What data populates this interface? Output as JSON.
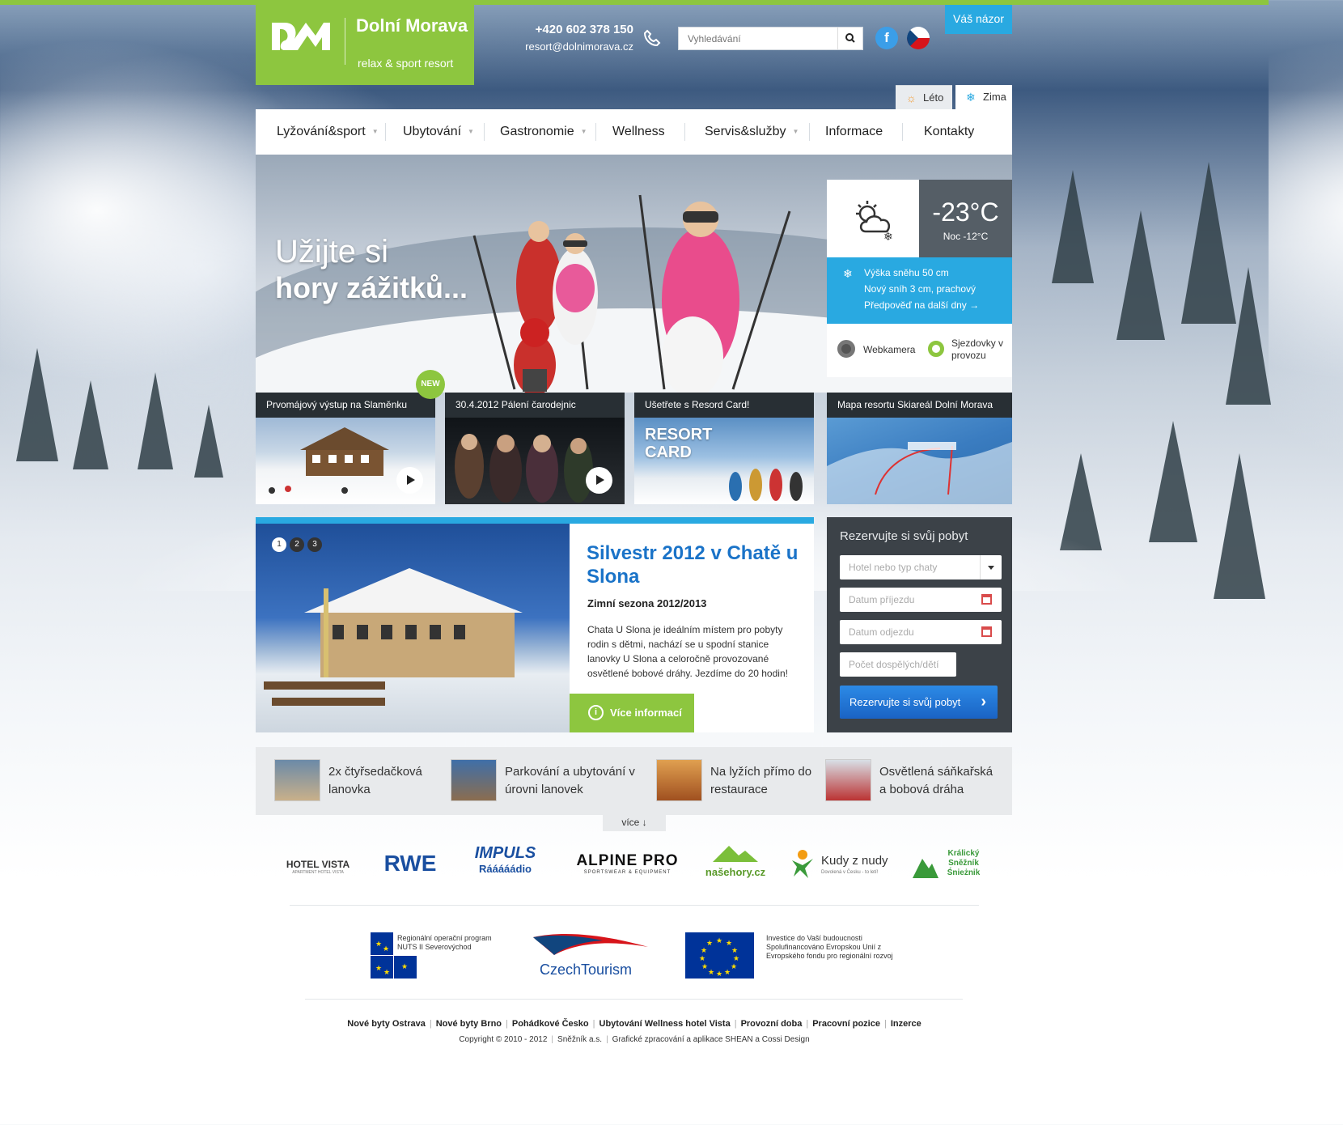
{
  "header": {
    "logo_name": "Dolní Morava",
    "logo_tagline": "relax & sport resort",
    "phone": "+420 602 378 150",
    "email": "resort@dolnimorava.cz",
    "search_placeholder": "Vyhledávání",
    "feedback_label": "Váš názor",
    "facebook_glyph": "f"
  },
  "seasons": {
    "summer": "Léto",
    "winter": "Zima",
    "active": "winter"
  },
  "nav": {
    "items": [
      {
        "label": "Lyžování&sport"
      },
      {
        "label": "Ubytování"
      },
      {
        "label": "Gastronomie"
      },
      {
        "label": "Wellness"
      },
      {
        "label": "Servis&služby"
      },
      {
        "label": "Informace"
      },
      {
        "label": "Kontakty"
      }
    ]
  },
  "hero": {
    "line1": "Užijte si",
    "line2": "hory zážitků..."
  },
  "weather": {
    "icon": "cloud-sun-snow-icon",
    "temperature": "-23°C",
    "night": "Noc -12°C",
    "snow_height": "Výška sněhu 50 cm",
    "new_snow": "Nový sníh 3 cm, prachový",
    "forecast_link": "Předpověď na další dny →",
    "webcam": "Webkamera",
    "slopes": "Sjezdovky v provozu"
  },
  "tiles": [
    {
      "caption": "Prvomájový výstup na Slaměnku",
      "video": true
    },
    {
      "caption": "30.4.2012 Pálení čarodejnic",
      "video": true
    },
    {
      "caption": "Ušetřete s Resord Card!",
      "video": false,
      "overlay": "RESORT CARD"
    },
    {
      "caption": "Mapa resortu Skiareál Dolní Morava",
      "video": false
    }
  ],
  "new_badge": "NEW",
  "feature": {
    "slides": [
      "1",
      "2",
      "3"
    ],
    "title": "Silvestr 2012 v Chatě u Slona",
    "subtitle": "Zimní sezona 2012/2013",
    "text": "Chata U Slona je ideálním místem pro pobyty rodin s dětmi, nachází se u spodní stanice lanovky U Slona a celoročně provozované osvětlené bobové dráhy. Jezdíme do 20 hodin!",
    "button": "Více informací",
    "info_glyph": "i"
  },
  "reservation": {
    "title": "Rezervujte si svůj pobyt",
    "hotel_placeholder": "Hotel nebo typ chaty",
    "arrival_placeholder": "Datum příjezdu",
    "departure_placeholder": "Datum odjezdu",
    "guests_placeholder": "Počet dospělých/dětí",
    "button": "Rezervujte si svůj pobyt"
  },
  "amenities": [
    {
      "text": "2x čtyřsedačková lanovka"
    },
    {
      "text": "Parkování a ubytování v úrovni lanovek"
    },
    {
      "text": "Na lyžích přímo do restaurace"
    },
    {
      "text": "Osvětlená sáňkařská a bobová dráha"
    }
  ],
  "more_label": "více ↓",
  "partners": [
    {
      "line1": "HOTEL VISTA",
      "line2": "APARTMENT HOTEL VISTA"
    },
    {
      "line1": "RWE"
    },
    {
      "line1": "IMPULS",
      "line2": "Rááááádio"
    },
    {
      "line1": "ALPINE PRO",
      "line2": "SPORTSWEAR & EQUIPMENT"
    },
    {
      "line1": "našehory.cz"
    },
    {
      "line1": "Kudy z nudy",
      "line2": "Dovolená v Česku - to letí!"
    },
    {
      "line1": "Králický Sněžník Śnieżnik"
    }
  ],
  "eu": {
    "rop_text": "Regionální operační program NUTS II Severovýchod",
    "czechtourism": "CzechTourism",
    "eu_text": "Investice do Vaší budoucnosti Spolufinancováno Evropskou Unií z Evropského fondu pro regionální rozvoj"
  },
  "footer": {
    "links": [
      "Nové byty Ostrava",
      "Nové byty Brno",
      "Pohádkové Česko",
      "Ubytování Wellness hotel Vista",
      "Provozní doba",
      "Pracovní pozice",
      "Inzerce"
    ],
    "copyright": "Copyright © 2010 - 2012",
    "company": "Sněžník a.s.",
    "credit": "Grafické zpracování a aplikace SHEAN a Cossi Design"
  },
  "colors": {
    "brand_green": "#8dc63f",
    "accent_blue": "#29a9e1",
    "title_blue": "#1a73c8",
    "dark": "#3c4248"
  }
}
